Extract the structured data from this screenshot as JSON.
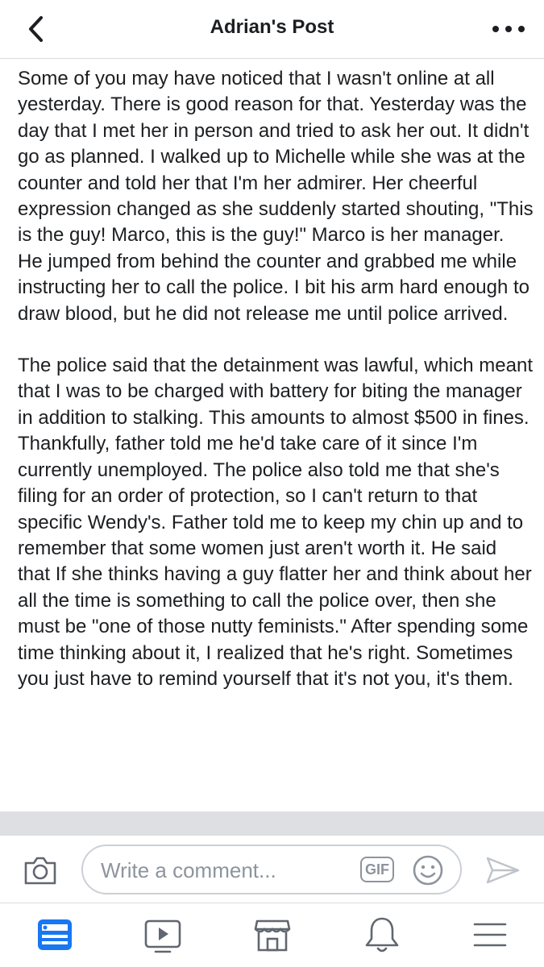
{
  "header": {
    "title": "Adrian's Post",
    "back_icon": "chevron-left-icon",
    "more_icon": "more-horizontal-icon"
  },
  "post": {
    "paragraphs": [
      "Some of you may have noticed that I wasn't online at all yesterday. There is good reason for that. Yesterday was the day that I met her in person and tried to ask her out. It didn't go as planned. I walked up to Michelle while she was at the counter and told her that I'm her admirer. Her cheerful expression changed as she suddenly started shouting, \"This is the guy! Marco, this is the guy!\" Marco is her manager. He jumped from behind the counter and grabbed me while instructing her to call the police. I bit his arm hard enough to draw blood, but he did not release me until police arrived.",
      "The police said that the detainment was lawful, which meant that I was to be charged with battery for biting the manager in addition to stalking. This amounts to almost $500 in fines. Thankfully, father told me he'd take care of it since I'm currently unemployed. The police also told me that she's filing for an order of protection, so I can't return to that specific Wendy's. Father told me to keep my chin up and to remember that some women just aren't worth it. He said that If she thinks having a guy flatter her and think about her all the time is something to call the police over, then she must be \"one of those nutty feminists.\" After spending some time thinking about it, I realized that he's right. Sometimes you just have to remind yourself that it's not you, it's them."
    ]
  },
  "comment_bar": {
    "placeholder": "Write a comment...",
    "gif_label": "GIF",
    "icons": [
      "camera-icon",
      "emoji-icon",
      "send-icon"
    ]
  },
  "tab_bar": {
    "tabs": [
      {
        "name": "news-feed",
        "icon": "news-feed-icon",
        "active": true
      },
      {
        "name": "watch",
        "icon": "video-play-icon",
        "active": false
      },
      {
        "name": "marketplace",
        "icon": "marketplace-icon",
        "active": false
      },
      {
        "name": "notifications",
        "icon": "bell-icon",
        "active": false
      },
      {
        "name": "menu",
        "icon": "menu-icon",
        "active": false
      }
    ]
  },
  "colors": {
    "accent": "#1877f2",
    "text": "#1c1e21",
    "icon_gray": "#8d949e",
    "divider": "#dddfe2"
  }
}
